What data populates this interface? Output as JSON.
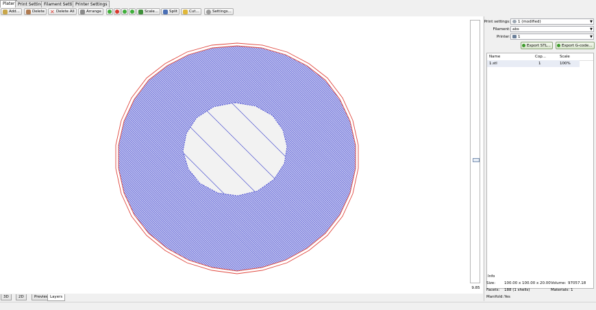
{
  "tabs": [
    {
      "label": "Plater",
      "active": true
    },
    {
      "label": "Print Settings",
      "active": false
    },
    {
      "label": "Filament Settings",
      "active": false
    },
    {
      "label": "Printer Settings",
      "active": false
    }
  ],
  "toolbar": {
    "add": "Add...",
    "delete": "Delete",
    "delete_all": "Delete All",
    "arrange": "Arrange",
    "round_buttons": [
      {
        "name": "increase-icon",
        "color": "#3fae3a"
      },
      {
        "name": "decrease-icon",
        "color": "#d9392f"
      },
      {
        "name": "rotate-left-icon",
        "color": "#3fae3a"
      },
      {
        "name": "rotate-right-icon",
        "color": "#3fae3a"
      }
    ],
    "scale": "Scale...",
    "split": "Split",
    "cut": "Cut...",
    "settings": "Settings..."
  },
  "layer_slider": {
    "value": "9.85"
  },
  "right_panel": {
    "print_settings_label": "Print settings:",
    "print_settings_value": "1 (modified)",
    "filament_label": "Filament:",
    "filament_value": "abs",
    "printer_label": "Printer:",
    "printer_value": "1",
    "export_stl": "Export STL...",
    "export_gcode": "Export G-code..."
  },
  "object_list": {
    "columns": [
      "Name",
      "Cop...",
      "Scale"
    ],
    "rows": [
      {
        "name": "1.stl",
        "copies": "1",
        "scale": "100%"
      }
    ]
  },
  "info": {
    "title": "Info",
    "size_label": "Size:",
    "size_value": "100.00 x 100.00 x 20.00",
    "volume_label": "Volume:",
    "volume_value": "97057.18",
    "facets_label": "Facets:",
    "facets_value": "188 (1 shells)",
    "materials_label": "Materials:",
    "materials_value": "1",
    "manifold_label": "Manifold:",
    "manifold_value": "Yes"
  },
  "view_tabs": [
    {
      "label": "3D",
      "active": false
    },
    {
      "label": "2D",
      "active": false
    },
    {
      "label": "Preview",
      "active": false
    },
    {
      "label": "Layers",
      "active": true
    }
  ],
  "colors": {
    "perimeter": "#e0453b",
    "infill": "#4b4fd0",
    "hole_fill": "#f2f2f2"
  }
}
